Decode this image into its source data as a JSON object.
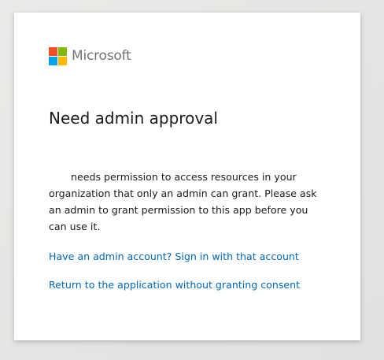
{
  "brand": {
    "name": "Microsoft",
    "logo_colors": [
      "#f25022",
      "#7fba00",
      "#00a4ef",
      "#ffb900"
    ]
  },
  "dialog": {
    "title": "Need admin approval",
    "app_name": "",
    "message": "needs permission to access resources in your organization that only an admin can grant. Please ask an admin to grant permission to this app before you can use it.",
    "links": {
      "admin_signin": "Have an admin account? Sign in with that account",
      "return_without_consent": "Return to the application without granting consent"
    }
  },
  "colors": {
    "link": "#0067b8",
    "text": "#1b1b1b",
    "brand_text": "#737373"
  }
}
